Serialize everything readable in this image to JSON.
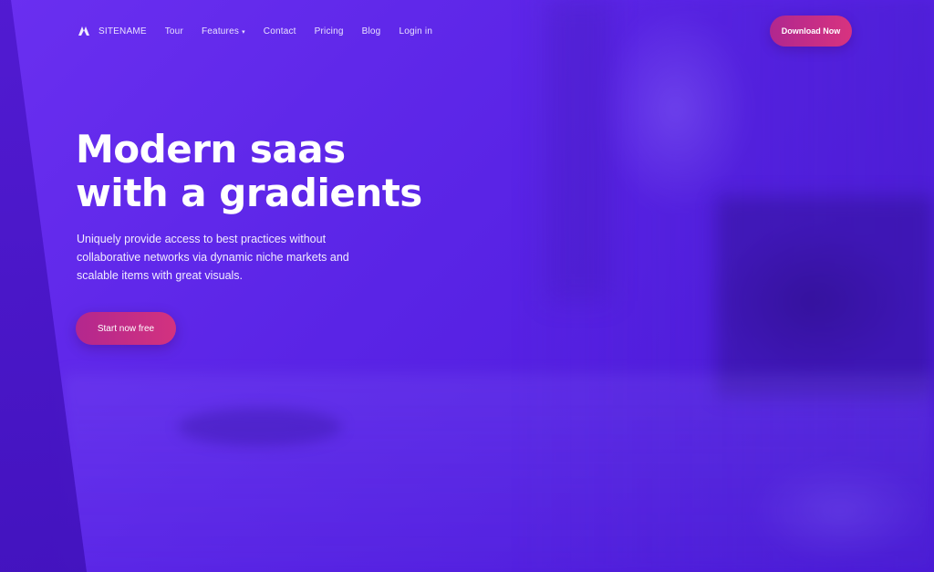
{
  "nav": {
    "brand": "SITENAME",
    "links": [
      "Tour",
      "Features",
      "Contact",
      "Pricing",
      "Blog",
      "Login in"
    ],
    "cta_label": "Download Now"
  },
  "hero": {
    "headline_line1": "Modern saas",
    "headline_line2": "with a gradients",
    "subtext_lines": [
      "Uniquely provide access to best practices without",
      "collaborative networks via dynamic niche markets and",
      "scalable items with great visuals."
    ],
    "cta_label": "Start now free"
  },
  "colors": {
    "background_start": "#6a2ff0",
    "background_end": "#4a18d8",
    "accent": "#d3327f",
    "text": "#ffffff"
  },
  "icons": {
    "brand": "brand-logo-icon",
    "dropdown": "chevron-down-icon"
  }
}
